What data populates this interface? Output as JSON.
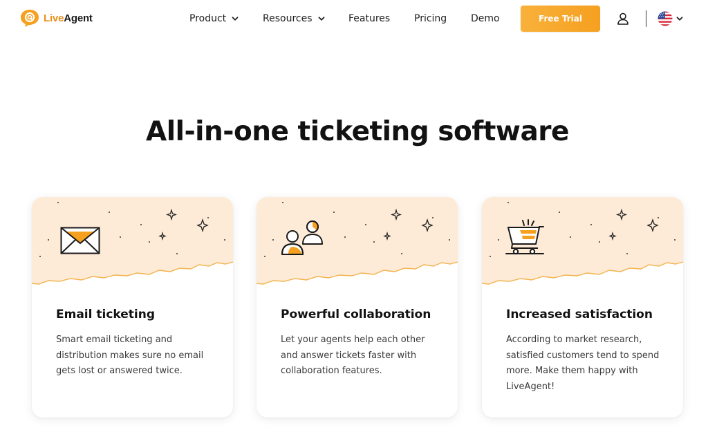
{
  "brand": {
    "name_part1": "Live",
    "name_part2": "Agent",
    "accent": "#f6a020"
  },
  "nav": {
    "items": [
      {
        "label": "Product",
        "has_dropdown": true
      },
      {
        "label": "Resources",
        "has_dropdown": true
      },
      {
        "label": "Features",
        "has_dropdown": false
      },
      {
        "label": "Pricing",
        "has_dropdown": false
      },
      {
        "label": "Demo",
        "has_dropdown": false
      }
    ],
    "cta_label": "Free Trial",
    "user_icon": "user-icon",
    "language_icon": "us-flag-icon"
  },
  "hero": {
    "headline": "All-in-one ticketing software"
  },
  "cards": [
    {
      "icon": "envelope-icon",
      "title": "Email ticketing",
      "text": "Smart email ticketing and distribution makes sure no email gets lost or answered twice."
    },
    {
      "icon": "users-icon",
      "title": "Powerful collaboration",
      "text": "Let your agents help each other and answer tickets faster with collaboration features."
    },
    {
      "icon": "shopping-cart-icon",
      "title": "Increased satisfaction",
      "text": "According to market research, satisfied customers tend to spend more. Make them happy with LiveAgent!"
    }
  ],
  "colors": {
    "banner": "#fdebd7",
    "banner_edge": "#f6b54a",
    "text_dark": "#111111"
  }
}
